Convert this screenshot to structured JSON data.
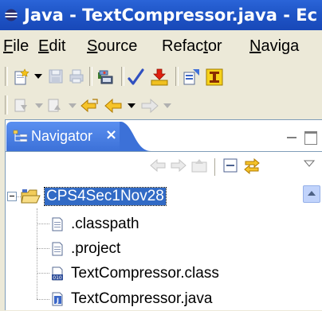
{
  "window": {
    "title": "Java - TextCompressor.java - Ec"
  },
  "menu": [
    {
      "label": "File",
      "mnemonic": "F",
      "rest": "ile"
    },
    {
      "label": "Edit",
      "mnemonic": "E",
      "rest": "dit"
    },
    {
      "label": "Source",
      "mnemonic": "S",
      "rest": "ource"
    },
    {
      "label": "Refactor",
      "pre": "Refac",
      "mnemonic": "t",
      "post": "or"
    },
    {
      "label": "Naviga",
      "mnemonic": "N",
      "rest": "aviga"
    }
  ],
  "navigator": {
    "tab_label": "Navigator",
    "close_glyph": "×",
    "tree": {
      "project": "CPS4Sec1Nov28",
      "children": [
        ".classpath",
        ".project",
        "TextCompressor.class",
        "TextCompressor.java"
      ]
    }
  },
  "colors": {
    "title_bar": "#1f55c7",
    "selection": "#316ac5",
    "view_tab": "#4a80e6"
  }
}
